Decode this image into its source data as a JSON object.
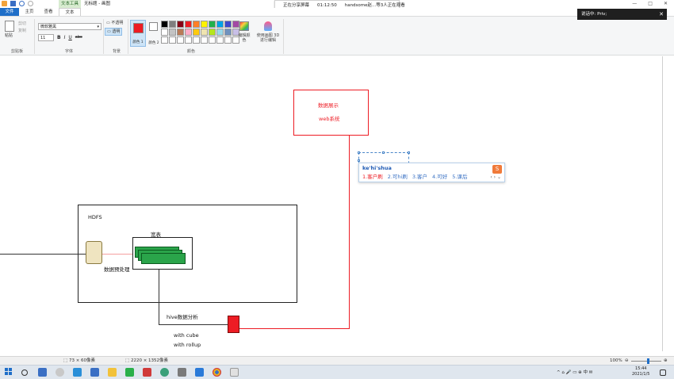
{
  "window": {
    "context_tab": "文本工具",
    "title": "无标题 - 画图",
    "controls": [
      "—",
      "□",
      "✕"
    ]
  },
  "share_bar": {
    "status": "正在分享屏幕",
    "time": "01:12:50",
    "viewers": "handsome赵...等3人正在观看"
  },
  "notification": {
    "text": "说话中: Priv;",
    "close": "✕"
  },
  "tabs": {
    "file": "文件",
    "home": "主页",
    "view": "查看",
    "text": "文本"
  },
  "ribbon": {
    "clipboard": {
      "paste": "粘贴",
      "cut": "剪切",
      "copy": "复制",
      "label": "剪贴板"
    },
    "font": {
      "name": "微软雅黑",
      "size": "11",
      "bold": "B",
      "italic": "I",
      "underline": "U",
      "strike": "abc",
      "label": "字体"
    },
    "background": {
      "opaque": "不透明",
      "transparent": "透明",
      "label": "背景"
    },
    "colors": {
      "color1_label": "颜色 1",
      "color2_label": "颜色 2",
      "edit_colors": "编辑颜色",
      "paint3d": "使用画图 3D 进行编辑",
      "label": "颜色",
      "palette": [
        "#000000",
        "#7f7f7f",
        "#880015",
        "#ed1c24",
        "#ff7f27",
        "#fff200",
        "#22b14c",
        "#00a2e8",
        "#3f48cc",
        "#a349a4",
        "#ffffff",
        "#c3c3c3",
        "#b97a57",
        "#ffaec9",
        "#ffc90e",
        "#efe4b0",
        "#b5e61d",
        "#99d9ea",
        "#7092be",
        "#c8bfe7",
        "#ffffff",
        "#ffffff",
        "#ffffff",
        "#ffffff",
        "#ffffff",
        "#ffffff",
        "#ffffff",
        "#ffffff",
        "#ffffff",
        "#ffffff"
      ]
    }
  },
  "canvas": {
    "web_title": "数据展示",
    "web_sub": "web系统",
    "hdfs": "HDFS",
    "wide_table": "宽表",
    "preprocess": "数据预处理",
    "hive": "hive数据分析",
    "cube": "with cube",
    "rollup": "with rollup",
    "ime_pinyin": "ke'hi'shua",
    "ime_candidates": [
      "1.客户刷",
      "2.可hi刷",
      "3.客户",
      "4.可好",
      "5.课后"
    ],
    "ime_arrows": "‹ › ⌄"
  },
  "statusbar": {
    "selection": "73 × 60像素",
    "canvas_size": "2220 × 1352像素",
    "zoom": "100%"
  },
  "taskbar": {
    "time": "15:44",
    "date": "2021/1/5",
    "tray_icons": "^ ⌂ 🎤 ▭ ⊕ 中 ✉"
  }
}
